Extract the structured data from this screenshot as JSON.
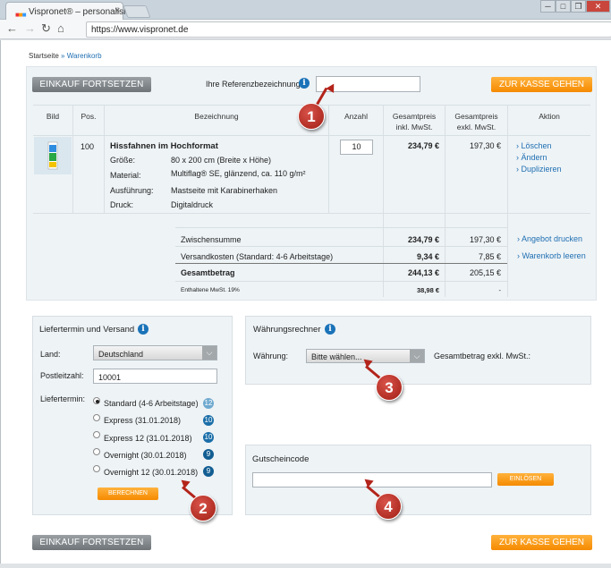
{
  "browser": {
    "tab_title": "Vispronet® – personalisi",
    "tab_close": "×",
    "url": "https://www.vispronet.de",
    "win_min": "─",
    "win_max": "□",
    "win_close": "✕"
  },
  "breadcrumb": {
    "home": "Startseite",
    "separator": "»",
    "current": "Warenkorb"
  },
  "top_bar": {
    "continue_label": "EINKAUF FORTSETZEN",
    "reference_label": "Ihre Referenzbezeichnung",
    "reference_value": "",
    "checkout_label": "ZUR KASSE GEHEN"
  },
  "table_headers": {
    "image": "Bild",
    "pos": "Pos.",
    "description": "Bezeichnung",
    "quantity": "Anzahl",
    "total_gross_1": "Gesamtpreis",
    "total_gross_2": "inkl. MwSt.",
    "total_net_1": "Gesamtpreis",
    "total_net_2": "exkl. MwSt.",
    "action": "Aktion"
  },
  "item": {
    "pos": "100",
    "title": "Hissfahnen im Hochformat",
    "specs": [
      {
        "label": "Größe:",
        "value": "80 x 200 cm (Breite x Höhe)"
      },
      {
        "label": "Material:",
        "value": "Multiflag® SE, glänzend, ca. 110 g/m²"
      },
      {
        "label": "Ausführung:",
        "value": "Mastseite mit Karabinerhaken"
      },
      {
        "label": "Druck:",
        "value": "Digitaldruck"
      }
    ],
    "quantity": "10",
    "total_gross": "234,79 €",
    "total_net": "197,30 €",
    "actions": [
      "› Löschen",
      "› Ändern",
      "› Duplizieren"
    ]
  },
  "summary": {
    "subtotal_label": "Zwischensumme",
    "subtotal_gross": "234,79 €",
    "subtotal_net": "197,30 €",
    "shipping_label": "Versandkosten (Standard: 4-6 Arbeitstage)",
    "shipping_gross": "9,34 €",
    "shipping_net": "7,85 €",
    "total_label": "Gesamtbetrag",
    "total_gross": "244,13 €",
    "total_net": "205,15 €",
    "vat_label": "Enthaltene MwSt. 19%",
    "vat_gross": "38,98 €",
    "vat_net": "-",
    "print_offer": "› Angebot drucken",
    "clear_cart": "› Warenkorb leeren"
  },
  "delivery": {
    "title": "Liefertermin und Versand",
    "country_label": "Land:",
    "country_value": "Deutschland",
    "zip_label": "Postleitzahl:",
    "zip_value": "10001",
    "date_label": "Liefertermin:",
    "options": [
      {
        "label": "Standard (4-6 Arbeitstage)",
        "badge": "12",
        "selected": true
      },
      {
        "label": "Express (31.01.2018)",
        "badge": "10",
        "selected": false
      },
      {
        "label": "Express 12 (31.01.2018)",
        "badge": "10",
        "selected": false
      },
      {
        "label": "Overnight (30.01.2018)",
        "badge": "9",
        "selected": false
      },
      {
        "label": "Overnight 12 (30.01.2018)",
        "badge": "9",
        "selected": false
      }
    ],
    "calc_label": "BERECHNEN"
  },
  "currency": {
    "title": "Währungsrechner",
    "currency_label": "Währung:",
    "currency_value": "Bitte wählen...",
    "total_label": "Gesamtbetrag exkl. MwSt.:"
  },
  "voucher": {
    "title": "Gutscheincode",
    "value": "",
    "redeem_label": "EINLÖSEN"
  },
  "bottom_bar": {
    "continue_label": "EINKAUF FORTSETZEN",
    "checkout_label": "ZUR KASSE GEHEN"
  },
  "markers": [
    "1",
    "2",
    "3",
    "4"
  ],
  "colors": {
    "accent_orange": "#f58a00",
    "info_blue": "#1a73b8",
    "link_blue": "#1f6fb2",
    "marker_red": "#b3241a"
  }
}
